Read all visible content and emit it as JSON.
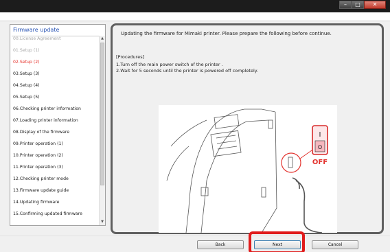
{
  "window": {
    "controls": [
      "–",
      "□",
      "✕"
    ]
  },
  "steps": {
    "title": "Firmware update",
    "items": [
      {
        "label": "00.License Agreement",
        "state": "done"
      },
      {
        "label": "01.Setup (1)",
        "state": "done"
      },
      {
        "label": "02.Setup (2)",
        "state": "current"
      },
      {
        "label": "03.Setup (3)",
        "state": "pending"
      },
      {
        "label": "04.Setup (4)",
        "state": "pending"
      },
      {
        "label": "05.Setup (5)",
        "state": "pending"
      },
      {
        "label": "06.Checking printer information",
        "state": "pending"
      },
      {
        "label": "07.Loading printer information",
        "state": "pending"
      },
      {
        "label": "08.Display of the firmware",
        "state": "pending"
      },
      {
        "label": "09.Printer operation (1)",
        "state": "pending"
      },
      {
        "label": "10.Printer operation (2)",
        "state": "pending"
      },
      {
        "label": "11.Printer operation (3)",
        "state": "pending"
      },
      {
        "label": "12.Checking printer mode",
        "state": "pending"
      },
      {
        "label": "13.Firmware update guide",
        "state": "pending"
      },
      {
        "label": "14.Updating firmware",
        "state": "pending"
      },
      {
        "label": "15.Confirming updated firmware",
        "state": "pending"
      }
    ],
    "scroll_up": "▲",
    "scroll_down": "▼"
  },
  "content": {
    "intro": "Updating the firmware for Mimaki printer. Please prepare the following before continue.",
    "procedures_heading": "[Procedures]",
    "procedures": [
      "1.Turn off the main power switch of the printer .",
      "2.Wait for 5 seconds until the printer is powered off completely."
    ],
    "illustration": {
      "switch_on_mark": "I",
      "switch_off_mark": "O",
      "off_label": "OFF"
    }
  },
  "footer": {
    "back_label": "Back",
    "next_label": "Next",
    "cancel_label": "Cancel"
  },
  "colors": {
    "current_step": "#e5302a",
    "done_step": "#a8a8a8",
    "title_link": "#2a55b5",
    "highlight": "#e01b1b"
  }
}
